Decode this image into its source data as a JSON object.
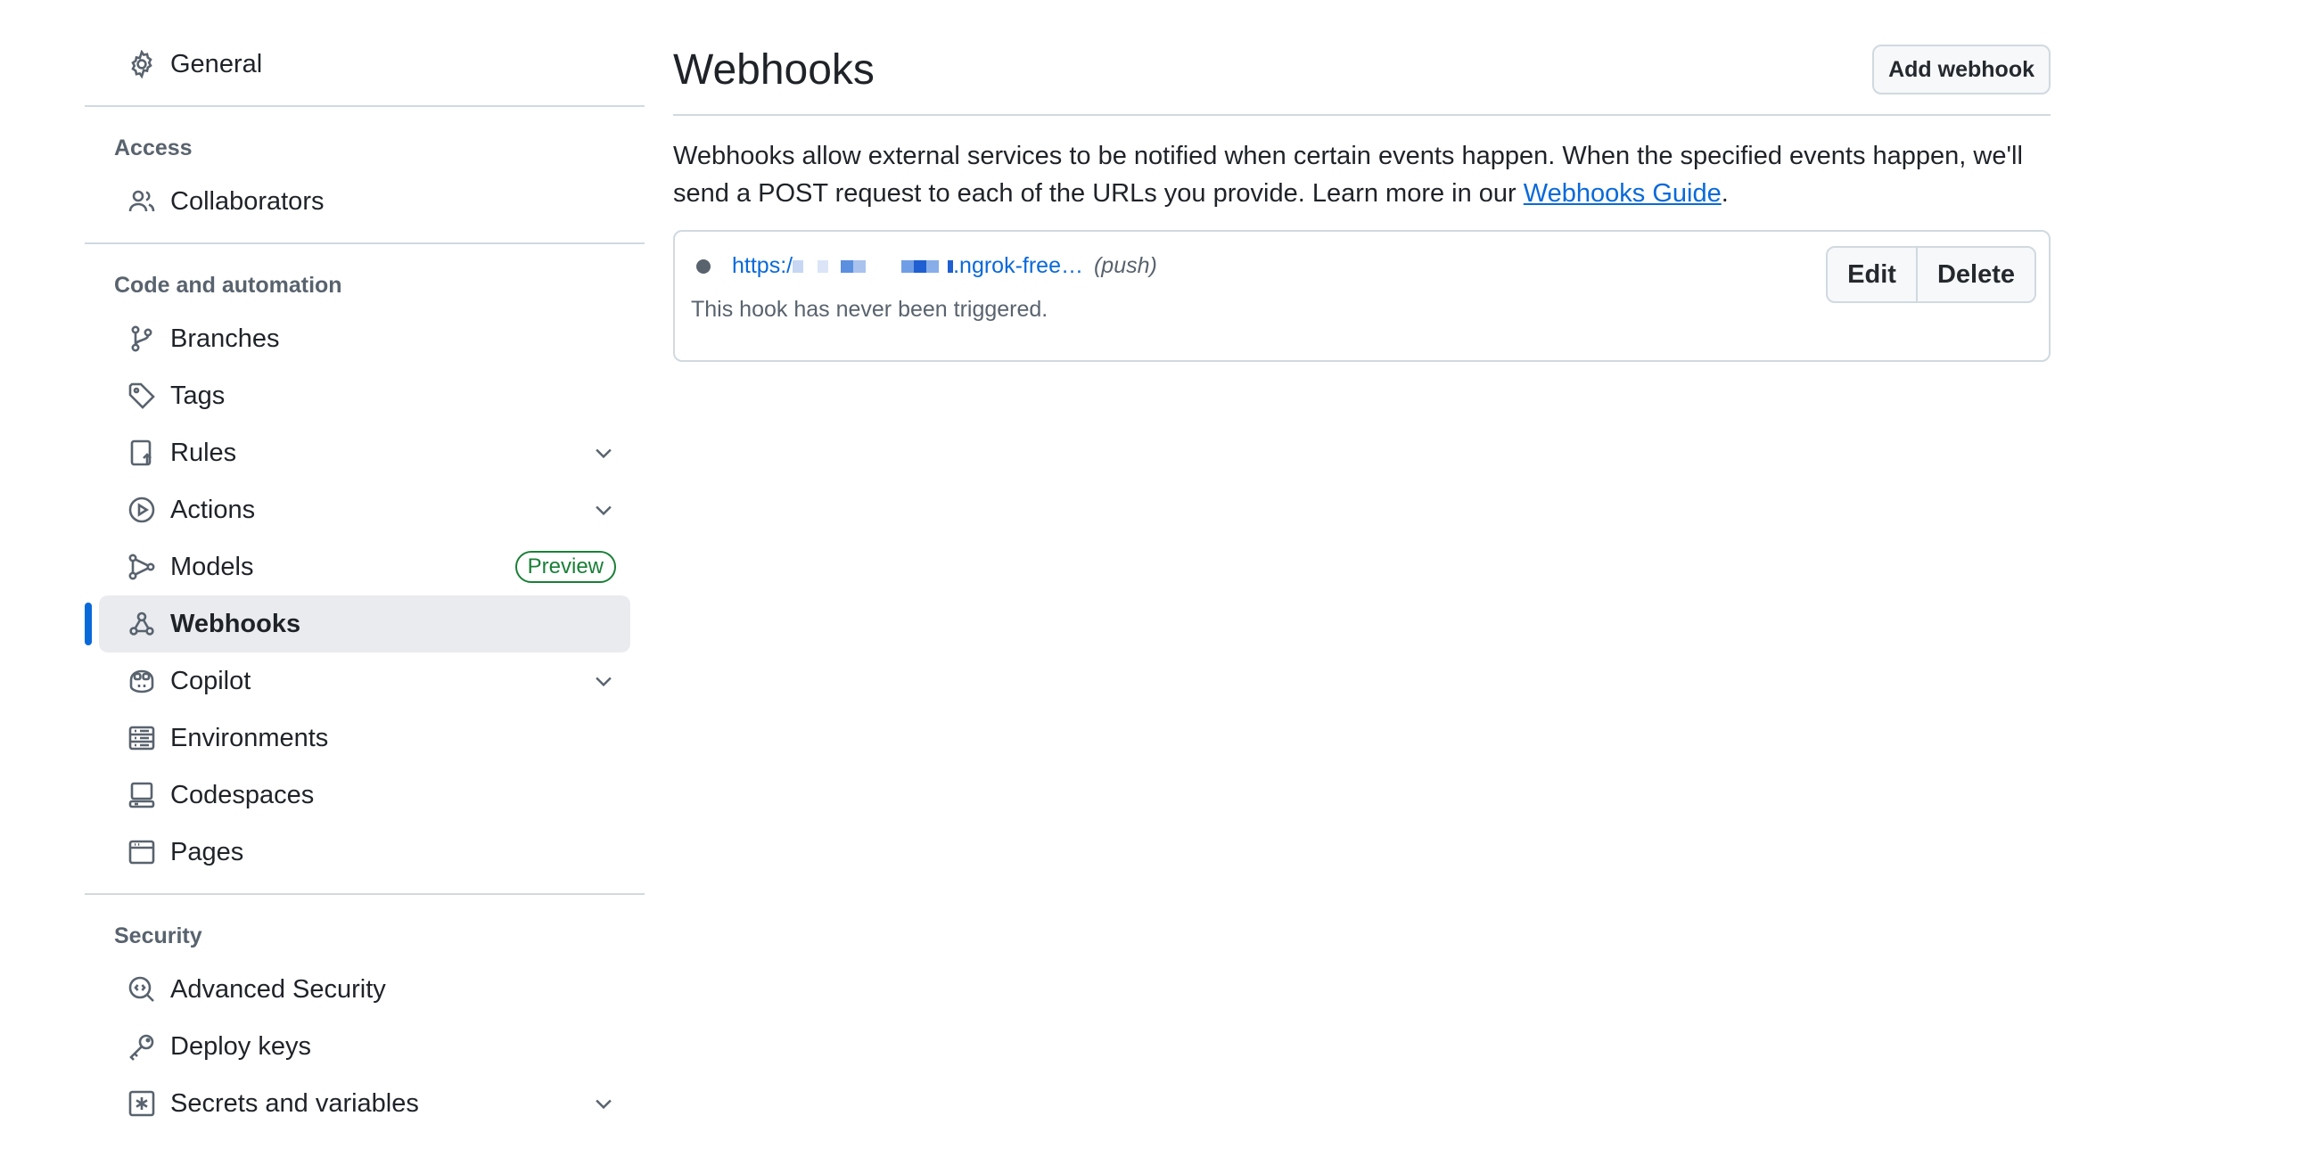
{
  "sidebar": {
    "general": "General",
    "access": {
      "heading": "Access",
      "items": [
        {
          "label": "Collaborators",
          "icon": "people-icon"
        }
      ]
    },
    "code": {
      "heading": "Code and automation",
      "items": [
        {
          "label": "Branches",
          "icon": "branch-icon"
        },
        {
          "label": "Tags",
          "icon": "tag-icon"
        },
        {
          "label": "Rules",
          "icon": "rules-icon"
        },
        {
          "label": "Actions",
          "icon": "play-icon"
        },
        {
          "label": "Models",
          "icon": "models-icon",
          "badge": "Preview"
        },
        {
          "label": "Webhooks",
          "icon": "webhook-icon"
        },
        {
          "label": "Copilot",
          "icon": "copilot-icon"
        },
        {
          "label": "Environments",
          "icon": "server-icon"
        },
        {
          "label": "Codespaces",
          "icon": "codespaces-icon"
        },
        {
          "label": "Pages",
          "icon": "browser-icon"
        }
      ]
    },
    "security": {
      "heading": "Security",
      "items": [
        {
          "label": "Advanced Security",
          "icon": "codescan-icon"
        },
        {
          "label": "Deploy keys",
          "icon": "key-icon"
        },
        {
          "label": "Secrets and variables",
          "icon": "asterisk-icon"
        }
      ]
    }
  },
  "main": {
    "title": "Webhooks",
    "add_button": "Add webhook",
    "description": "Webhooks allow external services to be notified when certain events happen. When the specified events happen, we'll send a POST request to each of the URLs you provide. Learn more in our ",
    "guide_link": "Webhooks Guide",
    "description_end": ".",
    "hook": {
      "url_prefix": "https:/",
      "url_suffix": ".ngrok-free…",
      "event": "(push)",
      "status": "This hook has never been triggered.",
      "edit": "Edit",
      "delete": "Delete"
    }
  },
  "colors": {
    "accent": "#0969da",
    "active_bg": "#e9ebef",
    "badge_green": "#1a7f37",
    "muted": "#59636e",
    "border": "#d1d9e0"
  }
}
